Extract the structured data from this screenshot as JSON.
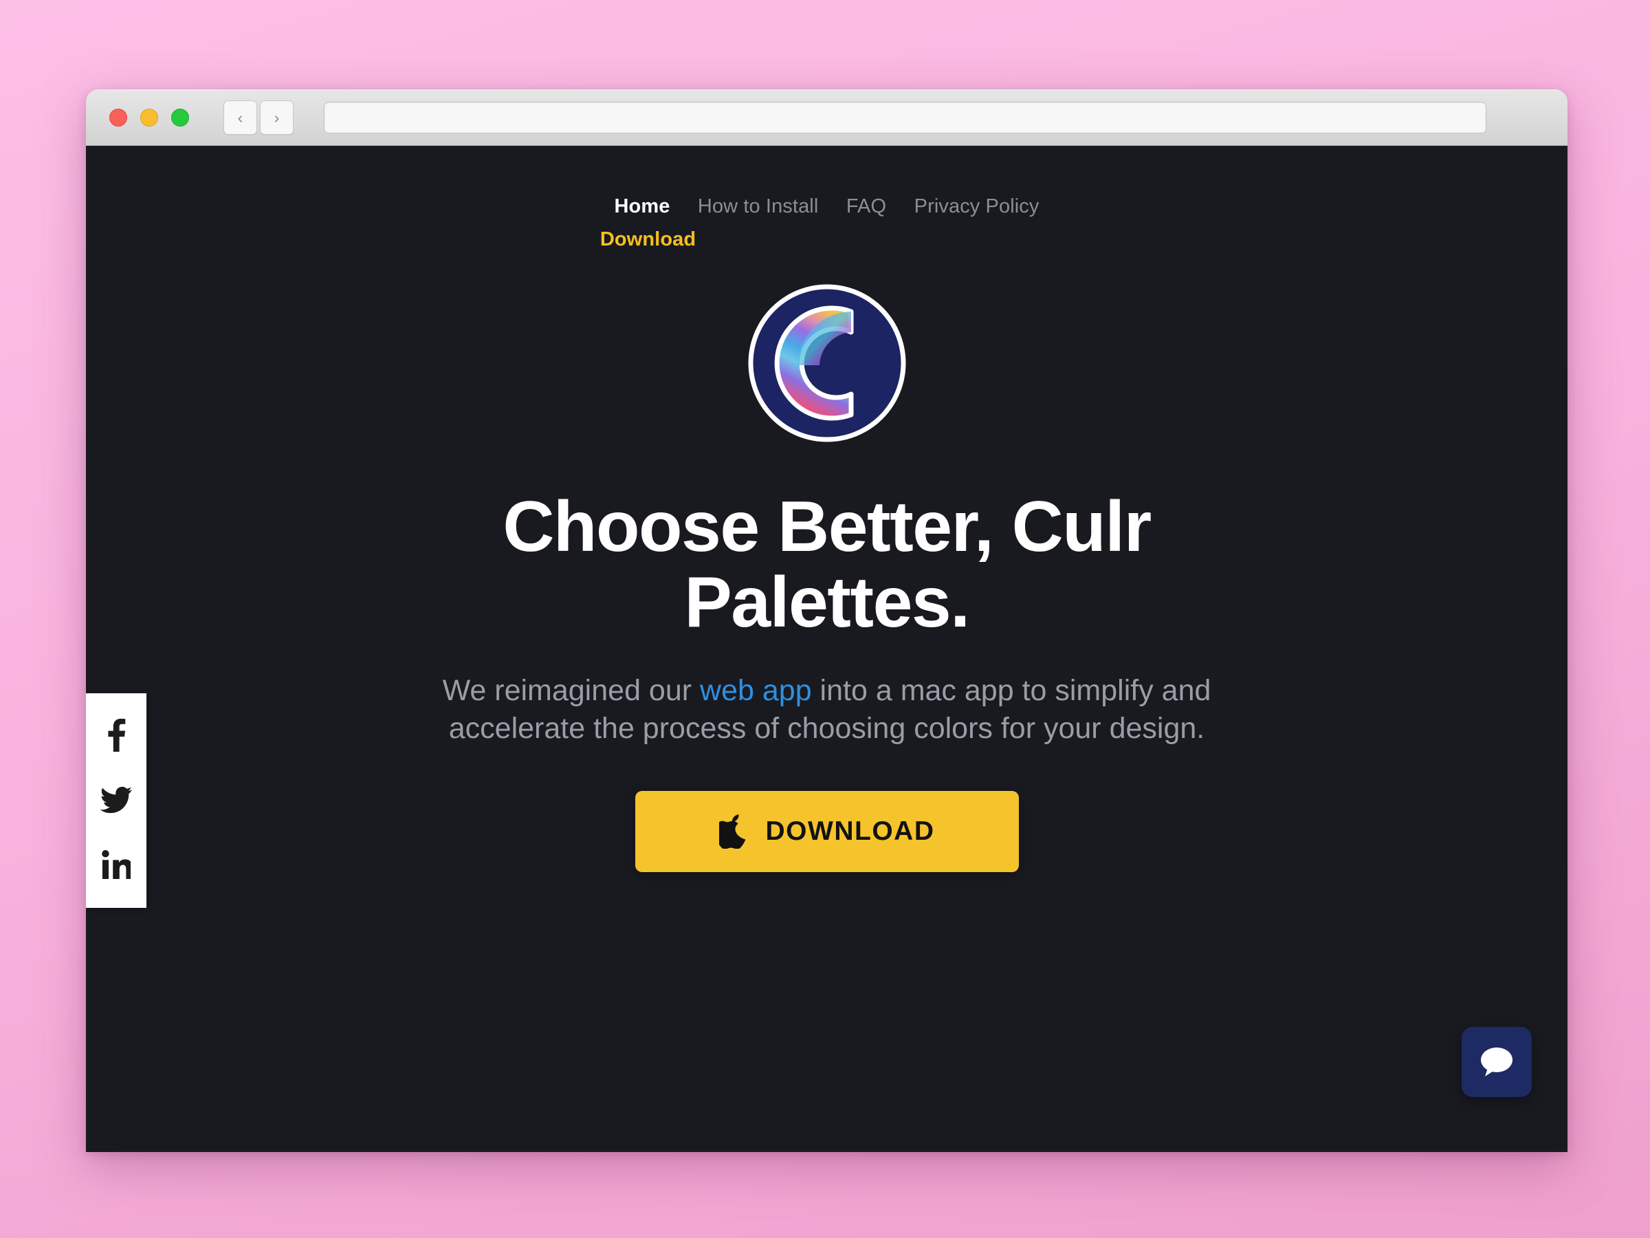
{
  "desktop": {
    "background_color": "#f8b2dd"
  },
  "browser": {
    "traffic_lights": [
      {
        "name": "close",
        "color": "#f96057"
      },
      {
        "name": "minimize",
        "color": "#f9bd2e"
      },
      {
        "name": "zoom",
        "color": "#27c93f"
      }
    ],
    "back_label": "‹",
    "forward_label": "›",
    "url_value": "",
    "url_placeholder": ""
  },
  "site": {
    "background_color": "#191a20",
    "nav": {
      "primary": [
        {
          "label": "Home",
          "active": true
        },
        {
          "label": "How to Install",
          "active": false
        },
        {
          "label": "FAQ",
          "active": false
        },
        {
          "label": "Privacy Policy",
          "active": false
        }
      ],
      "download_label": "Download",
      "download_color": "#f5c01f"
    },
    "hero": {
      "logo_alt": "culr-logo",
      "headline": "Choose Better, Culr Palettes.",
      "subtitle_before": "We reimagined our ",
      "subtitle_link": "web app",
      "subtitle_after": " into a mac app to simplify and accelerate the process of choosing colors for your design.",
      "link_color": "#2f8fe0",
      "download_button_label": "DOWNLOAD",
      "download_button_icon": "apple-icon",
      "download_button_color": "#f5c32c"
    },
    "social": [
      {
        "name": "facebook",
        "label": "f"
      },
      {
        "name": "twitter",
        "label": "t"
      },
      {
        "name": "linkedin",
        "label": "in"
      }
    ],
    "chat": {
      "icon": "chat-bubble-icon",
      "color": "#1d2a63"
    }
  }
}
